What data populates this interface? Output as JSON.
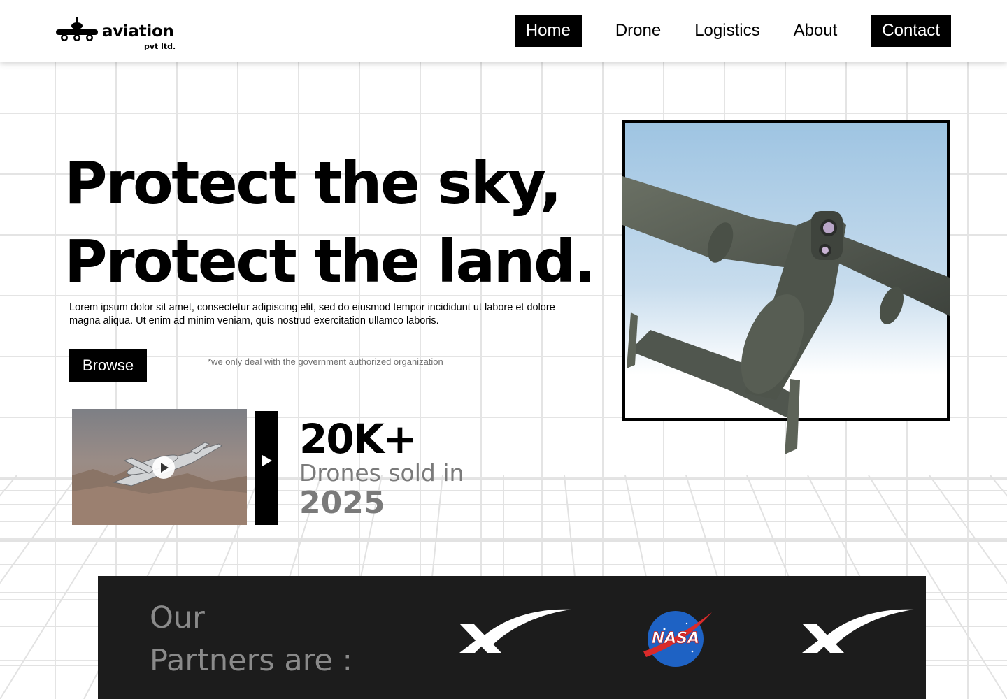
{
  "brand": {
    "name": "aviation",
    "suffix": "pvt ltd."
  },
  "nav": {
    "items": [
      "Home",
      "Drone",
      "Logistics",
      "About"
    ],
    "active": "Home",
    "contact_label": "Contact"
  },
  "hero": {
    "title_line1": "Protect the sky,",
    "title_line2": "Protect the land.",
    "description": "Lorem ipsum dolor sit amet, consectetur adipiscing elit, sed do eiusmod tempor incididunt ut labore et dolore magna aliqua. Ut enim ad minim veniam, quis nostrud exercitation ullamco laboris.",
    "browse_label": "Browse",
    "note": "*we only deal with the government authorized organization"
  },
  "stats": {
    "count": "20K+",
    "label": "Drones sold in",
    "year": "2025"
  },
  "partners": {
    "title_line1": "Our",
    "title_line2": "Partners are :",
    "logos": [
      "x-logo",
      "nasa-logo",
      "x-logo"
    ]
  },
  "colors": {
    "primary": "#000000",
    "muted_text": "#7a7a7a",
    "partners_bg": "#1c1c1c",
    "grid_line": "#e4e4e4"
  }
}
